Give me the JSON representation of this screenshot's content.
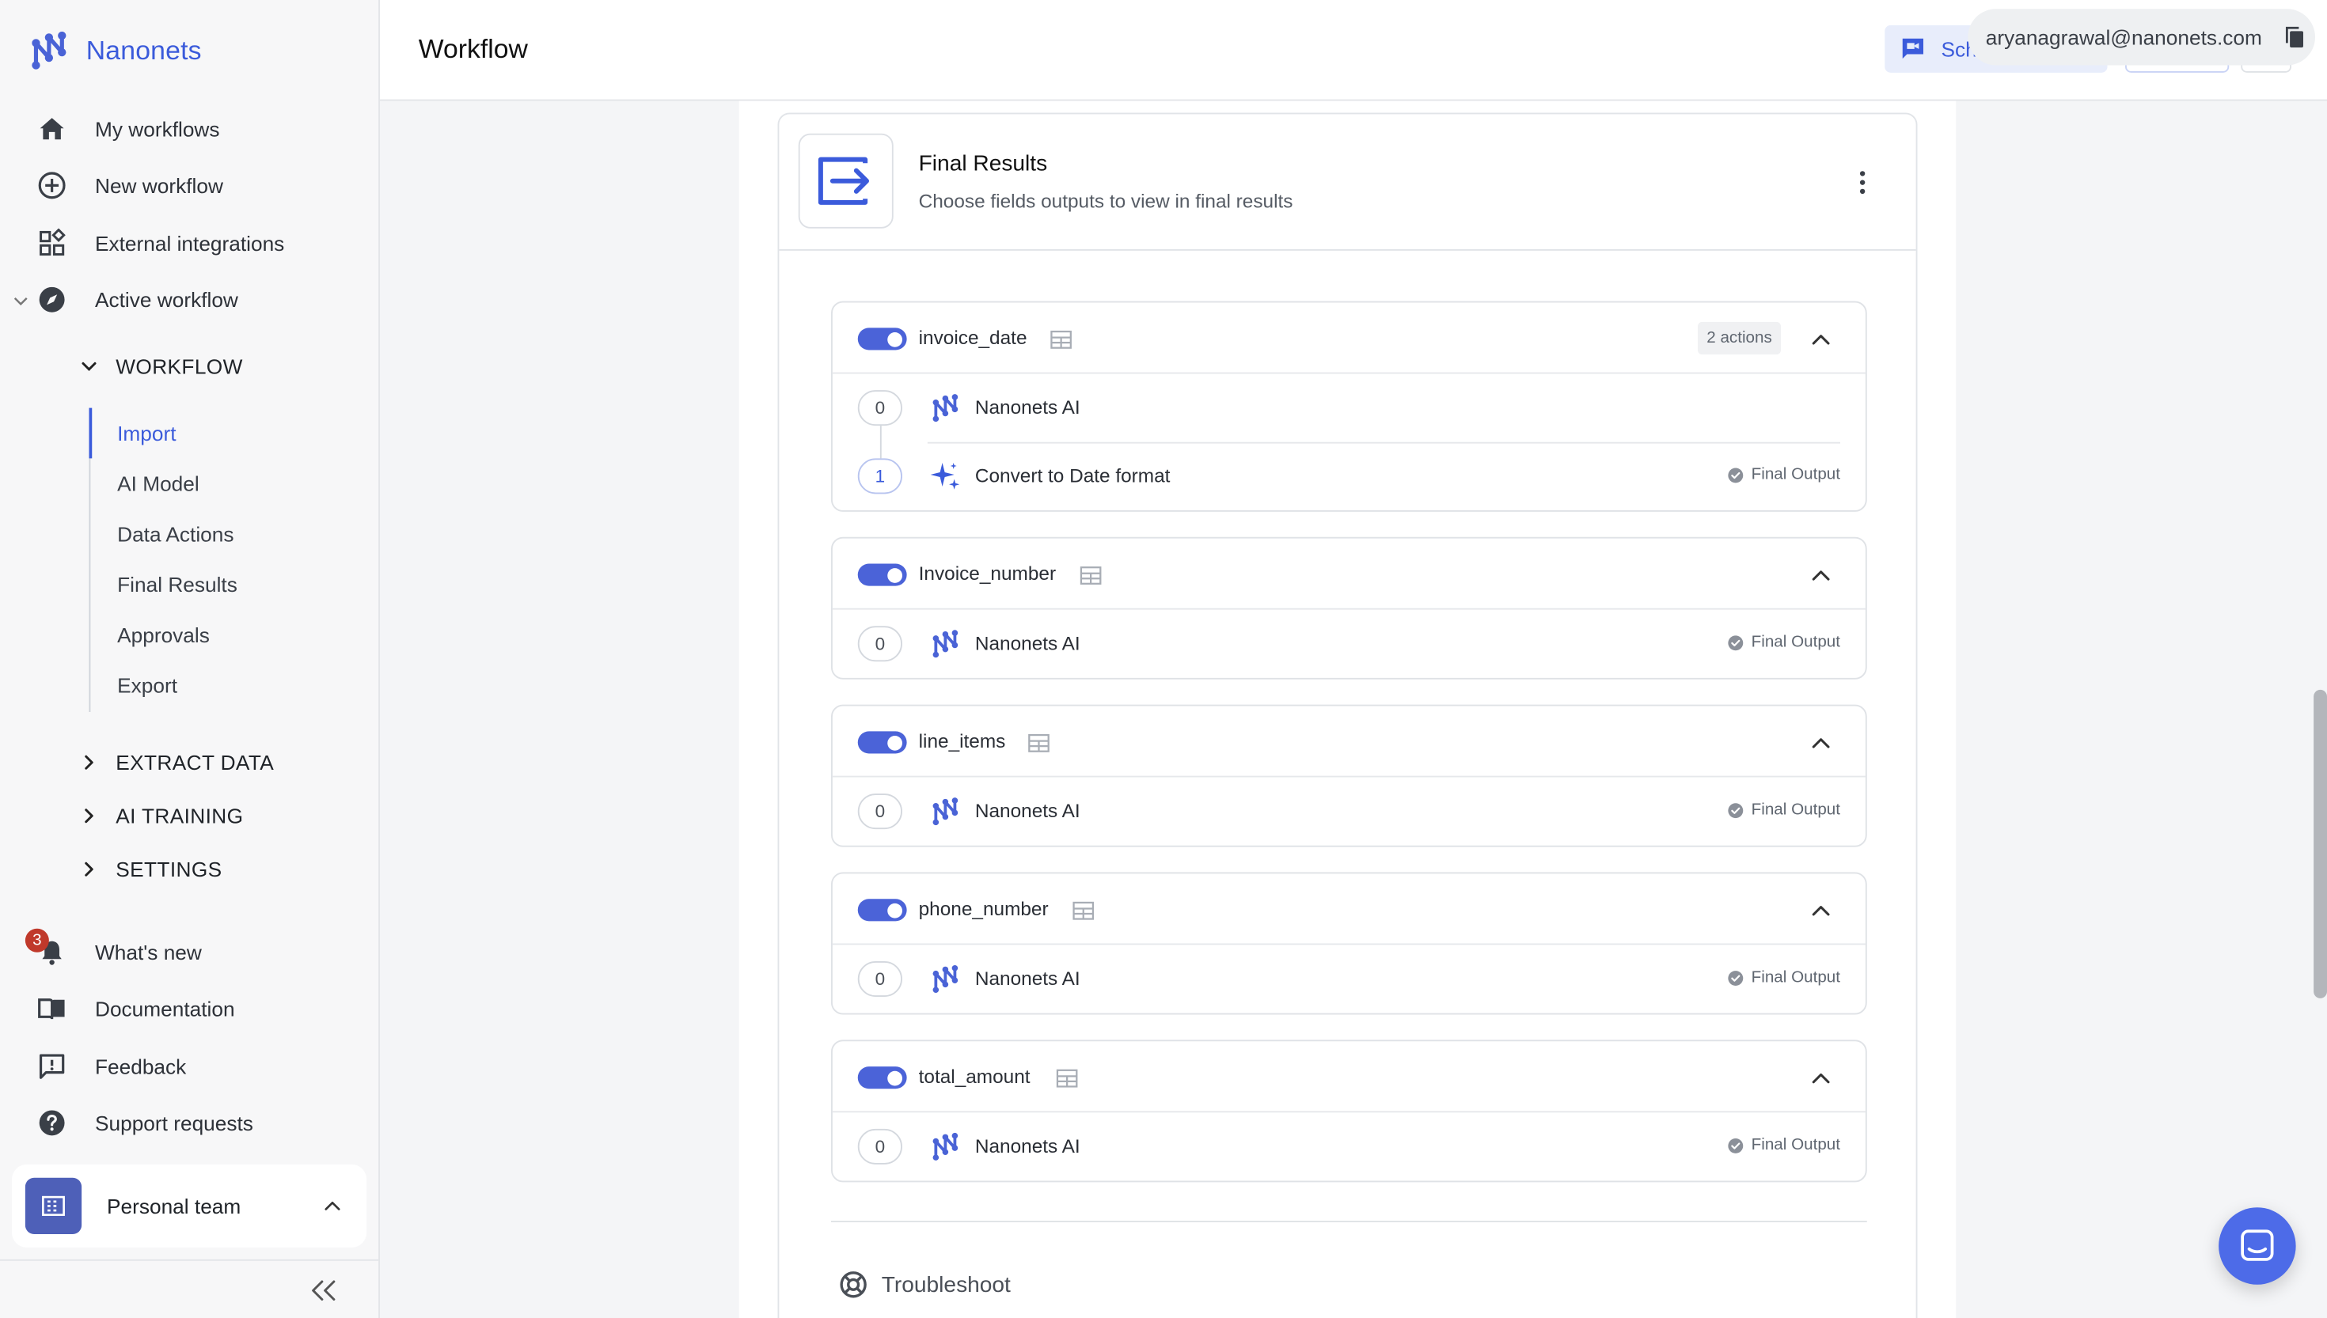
{
  "brand": {
    "name": "Nanonets"
  },
  "sidebar": {
    "nav": [
      {
        "label": "My workflows",
        "icon": "home-icon"
      },
      {
        "label": "New workflow",
        "icon": "plus-circle-icon"
      },
      {
        "label": "External integrations",
        "icon": "integrations-icon"
      },
      {
        "label": "Active workflow",
        "icon": "compass-icon"
      }
    ],
    "workflow_section": "WORKFLOW",
    "workflow_items": [
      "Import",
      "AI Model",
      "Data Actions",
      "Final Results",
      "Approvals",
      "Export"
    ],
    "active_item": "Import",
    "sections": [
      "EXTRACT DATA",
      "AI TRAINING",
      "SETTINGS"
    ],
    "bottom_nav": [
      {
        "label": "What's new",
        "icon": "bell-icon"
      },
      {
        "label": "Documentation",
        "icon": "book-icon"
      },
      {
        "label": "Feedback",
        "icon": "feedback-icon"
      },
      {
        "label": "Support requests",
        "icon": "help-icon"
      }
    ],
    "notification_count": "3",
    "team": "Personal team"
  },
  "header": {
    "title": "Workflow",
    "schedule_label": "Sch",
    "email": "aryanagrawal@nanonets.com"
  },
  "panel": {
    "title": "Final Results",
    "subtitle": "Choose fields outputs to view in final results"
  },
  "fields": [
    {
      "name": "invoice_date",
      "actions": "2 actions",
      "steps": [
        {
          "num": "0",
          "label": "Nanonets AI",
          "final": ""
        },
        {
          "num": "1",
          "label": "Convert to Date format",
          "final": "Final Output"
        }
      ]
    },
    {
      "name": "Invoice_number",
      "steps": [
        {
          "num": "0",
          "label": "Nanonets AI",
          "final": "Final Output"
        }
      ]
    },
    {
      "name": "line_items",
      "steps": [
        {
          "num": "0",
          "label": "Nanonets AI",
          "final": "Final Output"
        }
      ]
    },
    {
      "name": "phone_number",
      "steps": [
        {
          "num": "0",
          "label": "Nanonets AI",
          "final": "Final Output"
        }
      ]
    },
    {
      "name": "total_amount",
      "steps": [
        {
          "num": "0",
          "label": "Nanonets AI",
          "final": "Final Output"
        }
      ]
    }
  ],
  "troubleshoot": "Troubleshoot",
  "colors": {
    "accent": "#3b5bdb",
    "toggle": "#4b63d8",
    "notification": "#c0392b"
  }
}
